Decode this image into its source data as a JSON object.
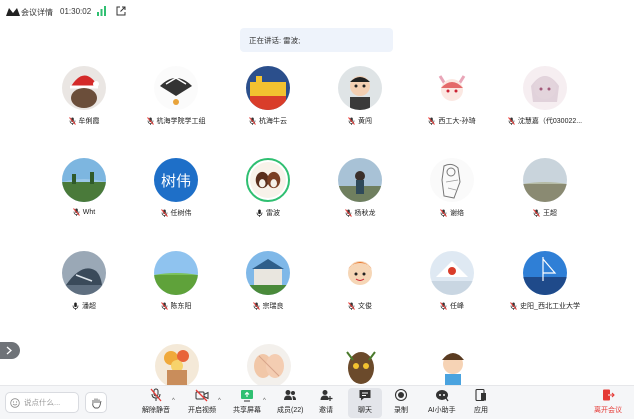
{
  "topbar": {
    "meeting_info_label": "会议详情",
    "timer": "01:30:02"
  },
  "speaking_banner": "正在讲话: 雷波;",
  "participants": [
    {
      "name": "牟俐霞",
      "mic": "muted"
    },
    {
      "name": "杭海学院学工组",
      "mic": "muted"
    },
    {
      "name": "杭海牛云",
      "mic": "muted"
    },
    {
      "name": "黄闯",
      "mic": "muted"
    },
    {
      "name": "西工大-孙琦",
      "mic": "muted"
    },
    {
      "name": "沈慧嘉（代030022...",
      "mic": "muted"
    },
    {
      "name": "Wht",
      "mic": "muted"
    },
    {
      "name": "任树伟",
      "mic": "muted",
      "avatar_text": "树伟"
    },
    {
      "name": "雷波",
      "mic": "on"
    },
    {
      "name": "杨秋龙",
      "mic": "muted"
    },
    {
      "name": "谢络",
      "mic": "muted"
    },
    {
      "name": "王超",
      "mic": "muted"
    },
    {
      "name": "潘超",
      "mic": "on"
    },
    {
      "name": "陈东阳",
      "mic": "muted"
    },
    {
      "name": "宗瑞良",
      "mic": "muted"
    },
    {
      "name": "文俊",
      "mic": "muted"
    },
    {
      "name": "任峰",
      "mic": "muted"
    },
    {
      "name": "史阳_西北工业大学",
      "mic": "muted"
    }
  ],
  "toolbar": {
    "chat_placeholder": "说点什么...",
    "unmute_label": "解除静音",
    "video_label": "开启视频",
    "share_label": "共享屏幕",
    "members_label": "成员(22)",
    "invite_label": "邀请",
    "chat_label": "聊天",
    "record_label": "录制",
    "ai_label": "AI小助手",
    "apps_label": "应用",
    "leave_label": "离开会议"
  },
  "colors": {
    "accent": "#2fbf71",
    "leave": "#e53935",
    "avatar_blue": "#1e6fc8",
    "mic_muted": "#e53935"
  }
}
